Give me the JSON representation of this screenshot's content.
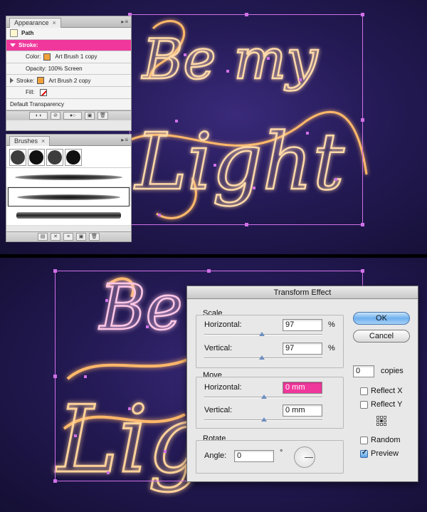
{
  "appearance_panel": {
    "tab_label": "Appearance",
    "rows": {
      "path": "Path",
      "stroke_header": "Stroke:",
      "color_label": "Color:",
      "color_value": "Art Brush 1 copy",
      "opacity_text": "Opacity: 100% Screen",
      "stroke2_label": "Stroke:",
      "stroke2_value": "Art Brush 2 copy",
      "fill_label": "Fill:",
      "transparency_text": "Default Transparency"
    }
  },
  "brushes_panel": {
    "tab_label": "Brushes"
  },
  "dialog": {
    "title": "Transform Effect",
    "scale": {
      "group_label": "Scale",
      "horizontal_label": "Horizontal:",
      "horizontal_value": "97",
      "horizontal_unit": "%",
      "vertical_label": "Vertical:",
      "vertical_value": "97",
      "vertical_unit": "%"
    },
    "move": {
      "group_label": "Move",
      "horizontal_label": "Horizontal:",
      "horizontal_value": "0 mm",
      "vertical_label": "Vertical:",
      "vertical_value": "0 mm"
    },
    "rotate": {
      "group_label": "Rotate",
      "angle_label": "Angle:",
      "angle_value": "0",
      "angle_unit": "°"
    },
    "ok_label": "OK",
    "cancel_label": "Cancel",
    "copies_value": "0",
    "copies_label": "copies",
    "reflect_x_label": "Reflect X",
    "reflect_y_label": "Reflect Y",
    "random_label": "Random",
    "preview_label": "Preview",
    "reflect_x_checked": false,
    "reflect_y_checked": false,
    "random_checked": false,
    "preview_checked": true
  },
  "artwork": {
    "line1": "Be my",
    "line2": "Light",
    "neon_color": "#ffd29a",
    "selection_color": "#d070e8"
  }
}
